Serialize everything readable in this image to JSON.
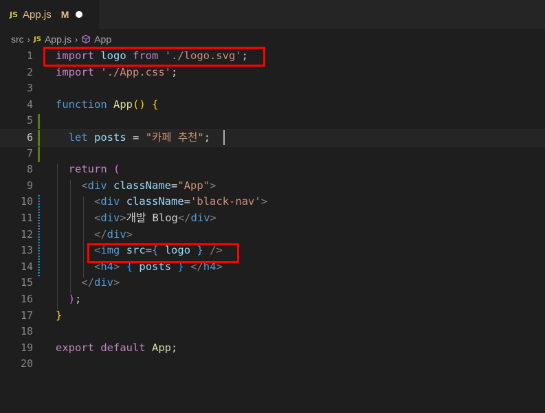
{
  "tab": {
    "badge": "JS",
    "filename": "App.js",
    "modified": "M"
  },
  "breadcrumb": {
    "folder": "src",
    "file_badge": "JS",
    "file": "App.js",
    "symbol": "App"
  },
  "lines": [
    {
      "n": "1",
      "tokens": [
        [
          "kw",
          "import"
        ],
        [
          "plain",
          " "
        ],
        [
          "var",
          "logo"
        ],
        [
          "plain",
          " "
        ],
        [
          "kw",
          "from"
        ],
        [
          "plain",
          " "
        ],
        [
          "str",
          "'./logo.svg'"
        ],
        [
          "plain",
          ";"
        ]
      ]
    },
    {
      "n": "2",
      "tokens": [
        [
          "kw",
          "import"
        ],
        [
          "plain",
          " "
        ],
        [
          "str",
          "'./App.css'"
        ],
        [
          "plain",
          ";"
        ]
      ]
    },
    {
      "n": "3",
      "tokens": []
    },
    {
      "n": "4",
      "tokens": [
        [
          "kb",
          "function"
        ],
        [
          "plain",
          " "
        ],
        [
          "fn",
          "App"
        ],
        [
          "br1",
          "()"
        ],
        [
          "plain",
          " "
        ],
        [
          "br1",
          "{"
        ]
      ]
    },
    {
      "n": "5",
      "tokens": []
    },
    {
      "n": "6",
      "tokens": [
        [
          "plain",
          "  "
        ],
        [
          "kb",
          "let"
        ],
        [
          "plain",
          " "
        ],
        [
          "var",
          "posts"
        ],
        [
          "plain",
          " = "
        ],
        [
          "str",
          "\"카페 추천\""
        ],
        [
          "plain",
          ";"
        ]
      ]
    },
    {
      "n": "7",
      "tokens": []
    },
    {
      "n": "8",
      "tokens": [
        [
          "plain",
          "  "
        ],
        [
          "kw",
          "return"
        ],
        [
          "plain",
          " "
        ],
        [
          "br2",
          "("
        ]
      ]
    },
    {
      "n": "9",
      "tokens": [
        [
          "plain",
          "    "
        ],
        [
          "tag",
          "<"
        ],
        [
          "tn",
          "div"
        ],
        [
          "plain",
          " "
        ],
        [
          "attr",
          "className"
        ],
        [
          "plain",
          "="
        ],
        [
          "str",
          "\"App\""
        ],
        [
          "tag",
          ">"
        ]
      ]
    },
    {
      "n": "10",
      "tokens": [
        [
          "plain",
          "      "
        ],
        [
          "tag",
          "<"
        ],
        [
          "tn",
          "div"
        ],
        [
          "plain",
          " "
        ],
        [
          "attr",
          "className"
        ],
        [
          "plain",
          "="
        ],
        [
          "str",
          "'black-nav'"
        ],
        [
          "tag",
          ">"
        ]
      ]
    },
    {
      "n": "11",
      "tokens": [
        [
          "plain",
          "      "
        ],
        [
          "tag",
          "<"
        ],
        [
          "tn",
          "div"
        ],
        [
          "tag",
          ">"
        ],
        [
          "txt",
          "개발 Blog"
        ],
        [
          "tag",
          "</"
        ],
        [
          "tn",
          "div"
        ],
        [
          "tag",
          ">"
        ]
      ]
    },
    {
      "n": "12",
      "tokens": [
        [
          "plain",
          "      "
        ],
        [
          "tag",
          "</"
        ],
        [
          "tn",
          "div"
        ],
        [
          "tag",
          ">"
        ]
      ]
    },
    {
      "n": "13",
      "tokens": [
        [
          "plain",
          "      "
        ],
        [
          "tag",
          "<"
        ],
        [
          "tn",
          "img"
        ],
        [
          "plain",
          " "
        ],
        [
          "attr",
          "src"
        ],
        [
          "plain",
          "="
        ],
        [
          "kb",
          "{"
        ],
        [
          "plain",
          " "
        ],
        [
          "var",
          "logo"
        ],
        [
          "plain",
          " "
        ],
        [
          "kb",
          "}"
        ],
        [
          "plain",
          " "
        ],
        [
          "tag",
          "/>"
        ]
      ]
    },
    {
      "n": "14",
      "tokens": [
        [
          "plain",
          "      "
        ],
        [
          "tag",
          "<"
        ],
        [
          "tn",
          "h4"
        ],
        [
          "tag",
          ">"
        ],
        [
          "plain",
          " "
        ],
        [
          "br3",
          "{"
        ],
        [
          "plain",
          " "
        ],
        [
          "var",
          "posts"
        ],
        [
          "plain",
          " "
        ],
        [
          "br3",
          "}"
        ],
        [
          "plain",
          " "
        ],
        [
          "tag",
          "</"
        ],
        [
          "tn",
          "h4"
        ],
        [
          "tag",
          ">"
        ]
      ]
    },
    {
      "n": "15",
      "tokens": [
        [
          "plain",
          "    "
        ],
        [
          "tag",
          "</"
        ],
        [
          "tn",
          "div"
        ],
        [
          "tag",
          ">"
        ]
      ]
    },
    {
      "n": "16",
      "tokens": [
        [
          "plain",
          "  "
        ],
        [
          "br2",
          ")"
        ],
        [
          "plain",
          ";"
        ]
      ]
    },
    {
      "n": "17",
      "tokens": [
        [
          "br1",
          "}"
        ]
      ]
    },
    {
      "n": "18",
      "tokens": []
    },
    {
      "n": "19",
      "tokens": [
        [
          "kw",
          "export"
        ],
        [
          "plain",
          " "
        ],
        [
          "kw",
          "default"
        ],
        [
          "plain",
          " "
        ],
        [
          "fn",
          "App"
        ],
        [
          "plain",
          ";"
        ]
      ]
    },
    {
      "n": "20",
      "tokens": []
    }
  ],
  "active_line": "6",
  "colors": {
    "highlight_box": "#ff0000",
    "gutter_added": "#587c0c",
    "gutter_modified": "#1b81a8"
  }
}
